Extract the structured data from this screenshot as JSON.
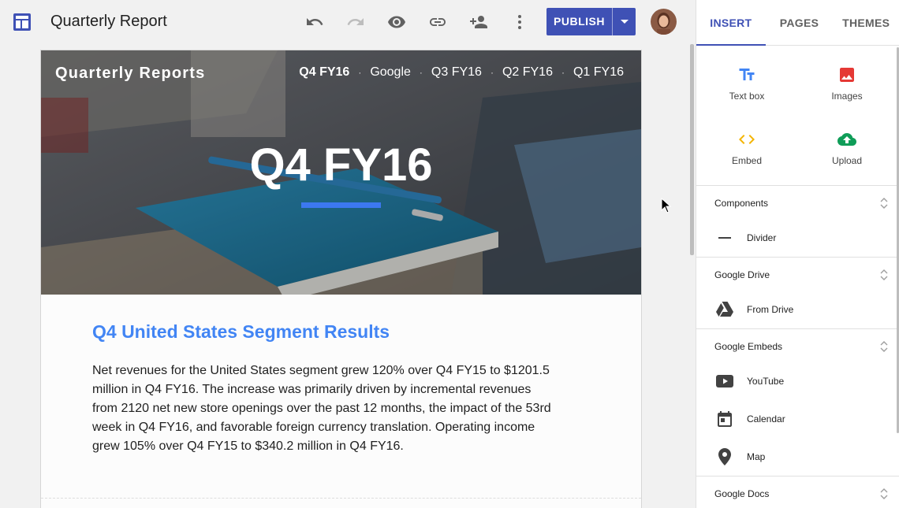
{
  "app": {
    "document_title": "Quarterly Report",
    "app_icon": "sites-layout-icon"
  },
  "toolbar": {
    "icons": [
      "undo-icon",
      "redo-icon",
      "preview-eye-icon",
      "link-icon",
      "add-person-icon",
      "more-vert-icon"
    ],
    "publish_label": "PUBLISH"
  },
  "site": {
    "title": "Quarterly Reports",
    "nav": [
      "Q4 FY16",
      "Google",
      "Q3 FY16",
      "Q2 FY16",
      "Q1 FY16"
    ],
    "hero_title": "Q4 FY16",
    "section_heading": "Q4 United States Segment Results",
    "body": "Net revenues for the United States segment grew 120% over Q4 FY15 to $1201.5 million in Q4 FY16. The increase was primarily driven by incremental revenues from 2120 net new store openings over the past 12 months, the impact of the 53rd week in Q4 FY16, and favorable foreign currency translation. Operating income grew 105% over Q4 FY15 to $340.2 million in Q4 FY16."
  },
  "panel": {
    "tabs": [
      "INSERT",
      "PAGES",
      "THEMES"
    ],
    "insert_items": [
      {
        "label": "Text box",
        "icon": "text-box-icon"
      },
      {
        "label": "Images",
        "icon": "image-icon"
      },
      {
        "label": "Embed",
        "icon": "embed-code-icon"
      },
      {
        "label": "Upload",
        "icon": "cloud-upload-icon"
      }
    ],
    "sections": [
      {
        "title": "Components",
        "items": [
          {
            "label": "Divider",
            "icon": "divider-icon"
          }
        ]
      },
      {
        "title": "Google Drive",
        "items": [
          {
            "label": "From Drive",
            "icon": "drive-icon"
          }
        ]
      },
      {
        "title": "Google Embeds",
        "items": [
          {
            "label": "YouTube",
            "icon": "youtube-icon"
          },
          {
            "label": "Calendar",
            "icon": "calendar-icon"
          },
          {
            "label": "Map",
            "icon": "map-pin-icon"
          }
        ]
      },
      {
        "title": "Google Docs",
        "items": []
      }
    ]
  },
  "colors": {
    "accent": "#3f51b5",
    "heading_blue": "#4285f4",
    "hero_underline": "#3c78f0"
  }
}
